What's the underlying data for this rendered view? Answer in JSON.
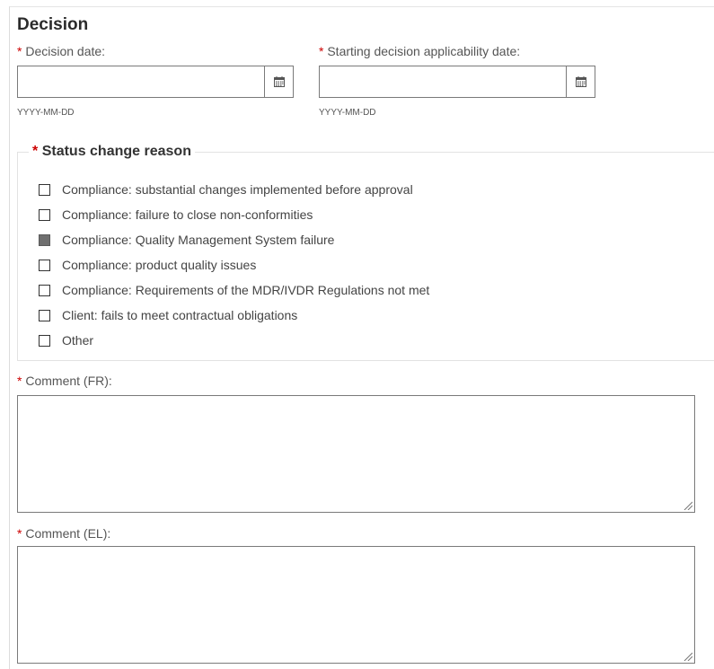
{
  "section": {
    "title": "Decision"
  },
  "required_marker": "*",
  "decision_date": {
    "label": "Decision date:",
    "value": "",
    "format_hint": "YYYY-MM-DD",
    "icon": "calendar-icon"
  },
  "applicability_date": {
    "label": "Starting decision applicability date:",
    "value": "",
    "format_hint": "YYYY-MM-DD",
    "icon": "calendar-icon"
  },
  "status_change_reason": {
    "legend": "Status change reason",
    "options": [
      {
        "label": "Compliance: substantial changes implemented before approval",
        "checked": false
      },
      {
        "label": "Compliance: failure to close non-conformities",
        "checked": false
      },
      {
        "label": "Compliance: Quality Management System failure",
        "checked": true
      },
      {
        "label": "Compliance: product quality issues",
        "checked": false
      },
      {
        "label": "Compliance: Requirements of the MDR/IVDR Regulations not met",
        "checked": false
      },
      {
        "label": "Client: fails to meet contractual obligations",
        "checked": false
      },
      {
        "label": "Other",
        "checked": false
      }
    ]
  },
  "comment_fr": {
    "label": "Comment (FR):",
    "value": ""
  },
  "comment_el": {
    "label": "Comment (EL):",
    "value": ""
  },
  "colors": {
    "required": "#cc0000",
    "checked_box": "#6f6f6f",
    "input_border": "#7a7a7a"
  }
}
